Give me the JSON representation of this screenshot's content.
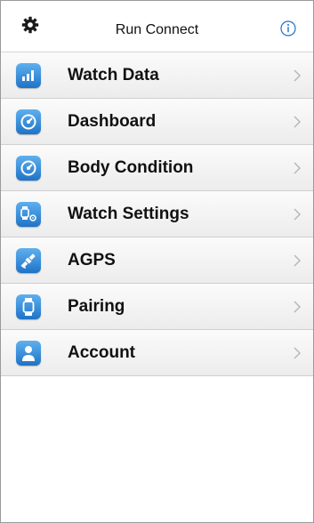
{
  "header": {
    "title": "Run Connect",
    "left_icon": "gear-icon",
    "right_icon": "info-icon"
  },
  "menu": [
    {
      "label": "Watch Data",
      "icon": "bar-chart-icon"
    },
    {
      "label": "Dashboard",
      "icon": "gauge-icon"
    },
    {
      "label": "Body Condition",
      "icon": "gauge-icon"
    },
    {
      "label": "Watch Settings",
      "icon": "watch-gear-icon"
    },
    {
      "label": "AGPS",
      "icon": "satellite-icon"
    },
    {
      "label": "Pairing",
      "icon": "watch-icon"
    },
    {
      "label": "Account",
      "icon": "person-icon"
    }
  ],
  "colors": {
    "icon_top": "#5fb0ef",
    "icon_bottom": "#1f73c6",
    "row_top": "#fbfbfb",
    "row_bottom": "#ececec",
    "chevron": "#b5b5b5"
  }
}
